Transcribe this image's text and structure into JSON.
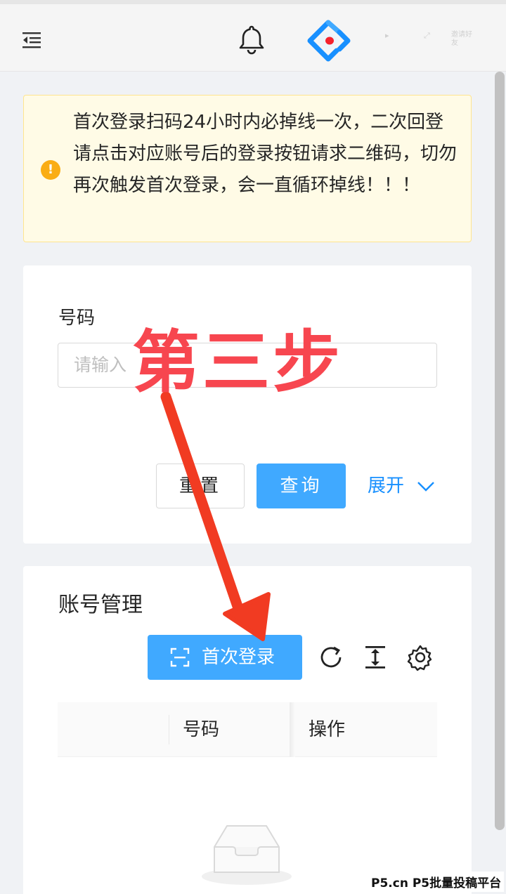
{
  "header": {
    "faint_label": "邀请好友"
  },
  "alert": {
    "icon": "!",
    "text": "首次登录扫码24小时内必掉线一次，二次回登请点击对应账号后的登录按钮请求二维码，切勿再次触发首次登录，会一直循环掉线！！！"
  },
  "search": {
    "field_label": "号码",
    "input_placeholder": "请输入",
    "reset_label": "重置",
    "query_label": "查询",
    "expand_label": "展开"
  },
  "account": {
    "title": "账号管理",
    "first_login_label": "首次登录",
    "columns": [
      "号码",
      "操作"
    ]
  },
  "overlay": {
    "step_text": "第三步"
  },
  "watermark": "P5.cn P5批量投稿平台",
  "colors": {
    "primary": "#40a9ff",
    "link": "#1890ff",
    "warning": "#faad14",
    "annotation_red": "#f7464f"
  }
}
